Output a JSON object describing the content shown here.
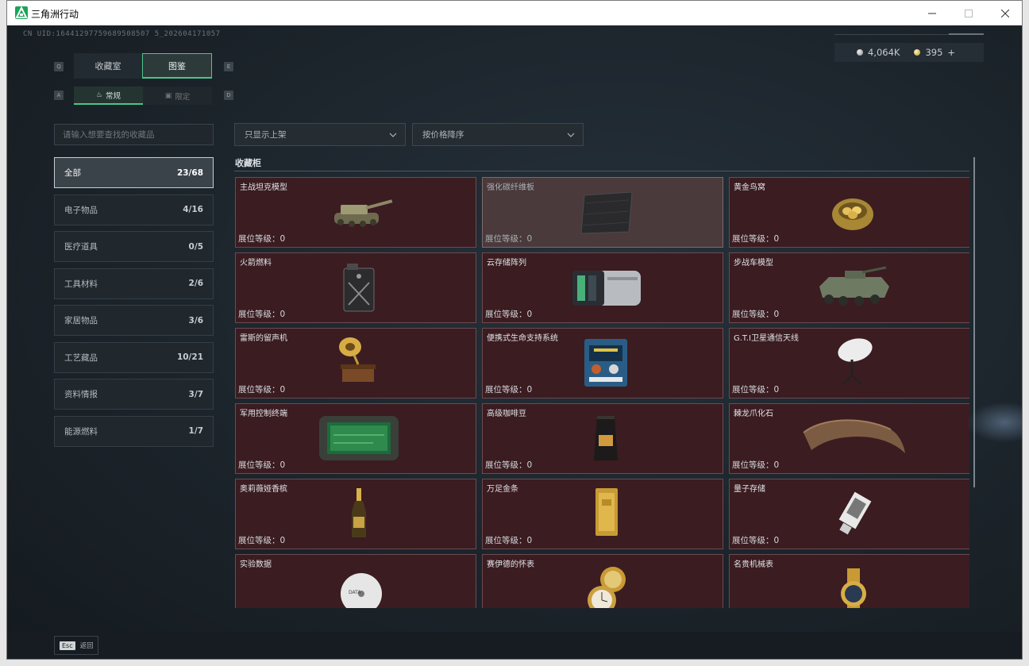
{
  "window": {
    "title": "三角洲行动"
  },
  "uid": "CN UID:16441297759689508507 5_202604171057",
  "currency": {
    "silver": "4,064K",
    "gold": "395",
    "add": "+"
  },
  "keyhints": {
    "q": "Q",
    "e": "E",
    "a": "A",
    "d": "D"
  },
  "tabs": [
    {
      "label": "收藏室"
    },
    {
      "label": "图鉴"
    }
  ],
  "subtabs": [
    {
      "label": "常规"
    },
    {
      "label": "限定"
    }
  ],
  "search": {
    "placeholder": "请输入想要查找的收藏品"
  },
  "filters": {
    "display": "只显示上架",
    "sort": "按价格降序"
  },
  "categories": [
    {
      "label": "全部",
      "count": "23/68"
    },
    {
      "label": "电子物品",
      "count": "4/16"
    },
    {
      "label": "医疗道具",
      "count": "0/5"
    },
    {
      "label": "工具材料",
      "count": "2/6"
    },
    {
      "label": "家居物品",
      "count": "3/6"
    },
    {
      "label": "工艺藏品",
      "count": "10/21"
    },
    {
      "label": "资料情报",
      "count": "3/7"
    },
    {
      "label": "能源燃料",
      "count": "1/7"
    }
  ],
  "section": {
    "title": "收藏柜"
  },
  "items": [
    {
      "name": "主战坦克模型",
      "level": "展位等级：0",
      "icon": "tank-model-icon"
    },
    {
      "name": "强化碳纤维板",
      "level": "展位等级：0",
      "icon": "carbon-plate-icon"
    },
    {
      "name": "黄金鸟窝",
      "level": "展位等级：0",
      "icon": "golden-nest-icon"
    },
    {
      "name": "火箭燃料",
      "level": "展位等级：0",
      "icon": "fuel-canister-icon"
    },
    {
      "name": "云存储阵列",
      "level": "展位等级：0",
      "icon": "storage-array-icon"
    },
    {
      "name": "步战车模型",
      "level": "展位等级：0",
      "icon": "ifv-model-icon"
    },
    {
      "name": "雷斯的留声机",
      "level": "展位等级：0",
      "icon": "gramophone-icon"
    },
    {
      "name": "便携式生命支持系统",
      "level": "展位等级：0",
      "icon": "life-support-icon"
    },
    {
      "name": "G.T.I卫星通信天线",
      "level": "展位等级：0",
      "icon": "satellite-dish-icon"
    },
    {
      "name": "军用控制终端",
      "level": "展位等级：0",
      "icon": "control-terminal-icon"
    },
    {
      "name": "高级咖啡豆",
      "level": "展位等级：0",
      "icon": "coffee-bag-icon"
    },
    {
      "name": "棘龙爪化石",
      "level": "展位等级：0",
      "icon": "claw-fossil-icon"
    },
    {
      "name": "奥莉薇娅香槟",
      "level": "展位等级：0",
      "icon": "champagne-icon"
    },
    {
      "name": "万足金条",
      "level": "展位等级：0",
      "icon": "gold-bar-icon"
    },
    {
      "name": "量子存储",
      "level": "展位等级：0",
      "icon": "quantum-drive-icon"
    },
    {
      "name": "实验数据",
      "level": "",
      "icon": "data-disc-icon"
    },
    {
      "name": "赛伊德的怀表",
      "level": "",
      "icon": "pocket-watch-icon"
    },
    {
      "name": "名贵机械表",
      "level": "",
      "icon": "wristwatch-icon"
    }
  ],
  "footer": {
    "esc_key": "Esc",
    "esc_label": "返回"
  },
  "colors": {
    "accent": "#4cc58a",
    "card_bg": "#3b1c21",
    "card_border": "#6b4b50"
  }
}
